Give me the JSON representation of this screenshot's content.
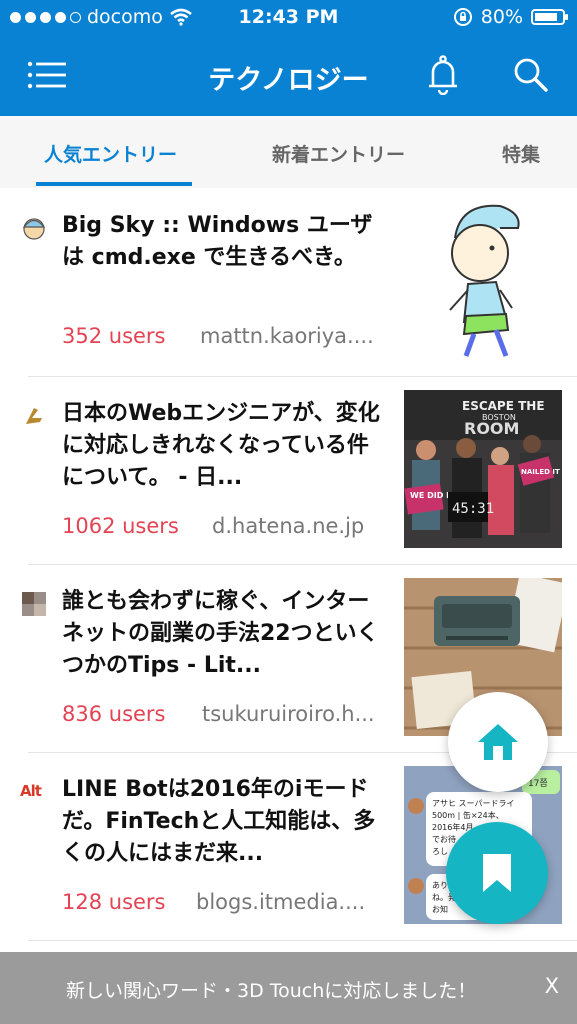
{
  "status_bar": {
    "carrier": "docomo",
    "time": "12:43 PM",
    "battery": "80%",
    "icons": [
      "signal-dots-icon",
      "wifi-icon",
      "rotation-lock-icon",
      "battery-icon"
    ]
  },
  "header": {
    "title": "テクノロジー",
    "icons": [
      "menu-icon",
      "bell-icon",
      "search-icon"
    ]
  },
  "tabs": [
    {
      "label": "人気エントリー",
      "active": true
    },
    {
      "label": "新着エントリー",
      "active": false
    },
    {
      "label": "特集",
      "active": false
    }
  ],
  "entries": [
    {
      "title": "Big Sky :: Windows ユーザは cmd.exe で生きるべき。",
      "users": "352 users",
      "domain": "mattn.kaoriya...."
    },
    {
      "title": "日本のWebエンジニアが、変化に対応しきれなくなっている件について。 - 日...",
      "users": "1062 users",
      "domain": "d.hatena.ne.jp",
      "thumb_text": [
        "ESCAPE THE",
        "BOSTON",
        "ROOM",
        "WE DID IT",
        "NAILED IT",
        "45:31"
      ]
    },
    {
      "title": "誰とも会わずに稼ぐ、インターネットの副業の手法22つといくつかのTips - Lit...",
      "users": "836 users",
      "domain": "tsukuruiroiro.h..."
    },
    {
      "title": "LINE Botは2016年のiモードだ。FinTechと人工知能は、多くの人にはまだ来...",
      "users": "128 users",
      "domain": "blogs.itmedia....",
      "favicon_text": "Alt",
      "thumb_text": [
        "アサヒ スーパードライ",
        "500m | 缶×24本、",
        "2016年4月",
        "でお待",
        "ろし",
        "ありが",
        "ね。発",
        "お知",
        "17쯤"
      ]
    }
  ],
  "fab": {
    "icons": [
      "home-icon",
      "bookmark-icon"
    ]
  },
  "notice": {
    "text": "新しい関心ワード・3D Touchに対応しました！",
    "close": "X"
  },
  "colors": {
    "primary": "#0a82d3",
    "users": "#e34353",
    "fab_teal": "#15b5c4",
    "notice_bg": "#9b9b9b"
  }
}
